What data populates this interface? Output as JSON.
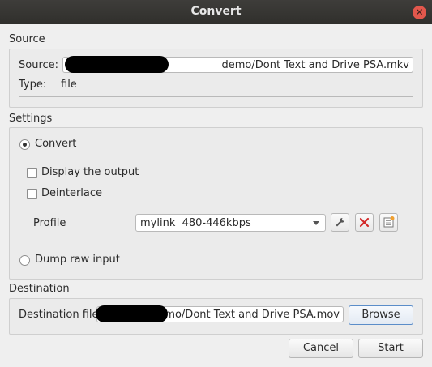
{
  "window": {
    "title": "Convert"
  },
  "source": {
    "section_label": "Source",
    "source_label": "Source:",
    "source_value": "demo/Dont Text and Drive PSA.mkv",
    "type_label": "Type:",
    "type_value": "file"
  },
  "settings": {
    "section_label": "Settings",
    "convert_label": "Convert",
    "display_output_label": "Display the output",
    "deinterlace_label": "Deinterlace",
    "profile_label": "Profile",
    "profile_value": "mylink  480-446kbps",
    "dump_raw_label": "Dump raw input",
    "convert_selected": true,
    "display_output_checked": false,
    "deinterlace_checked": false
  },
  "destination": {
    "section_label": "Destination",
    "file_label": "Destination file:",
    "file_value": "demo/Dont Text and Drive PSA.mov",
    "browse_label": "Browse"
  },
  "footer": {
    "cancel_label": "Cancel",
    "start_label": "Start"
  },
  "icons": [
    "close-icon",
    "wrench-icon",
    "delete-icon",
    "new-profile-icon"
  ],
  "colors": {
    "titlebar": "#353431",
    "close": "#e2574c",
    "delete_red": "#d32b2b",
    "focus_border": "#5b8dc9"
  }
}
